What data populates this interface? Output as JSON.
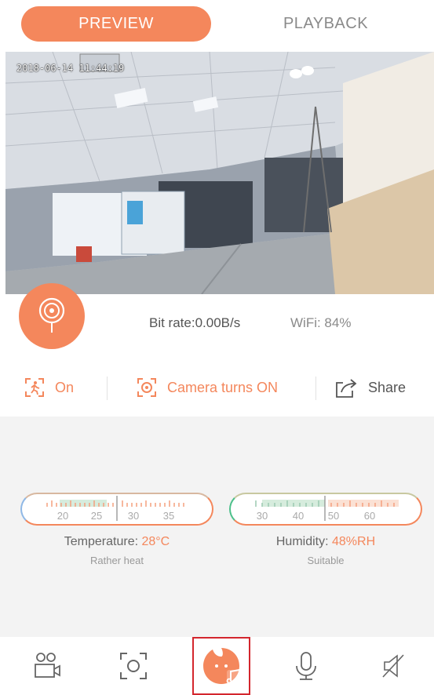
{
  "tabs": {
    "preview_label": "PREVIEW",
    "playback_label": "PLAYBACK"
  },
  "video": {
    "timestamp": "2018-06-14 11:44:19"
  },
  "stats": {
    "bitrate_label": "Bit rate:",
    "bitrate_value": "0.00B/s",
    "wifi_text": "WiFi: 84%"
  },
  "controls": {
    "motion_label": "On",
    "camera_label": "Camera turns ON",
    "share_label": "Share"
  },
  "temperature": {
    "label": "Temperature: ",
    "value": "28°C",
    "status": "Rather heat",
    "ticks": [
      "20",
      "25",
      "30",
      "35"
    ]
  },
  "humidity": {
    "label": "Humidity: ",
    "value": "48%RH",
    "status": "Suitable",
    "ticks": [
      "30",
      "40",
      "50",
      "60"
    ]
  },
  "bottom_bar": {
    "items": [
      "contacts-camera-icon",
      "screenshot-icon",
      "music-icon",
      "microphone-icon",
      "speaker-mute-icon"
    ],
    "active": "music-icon"
  },
  "colors": {
    "accent": "#f4875c",
    "active_outline": "#d3262d"
  }
}
